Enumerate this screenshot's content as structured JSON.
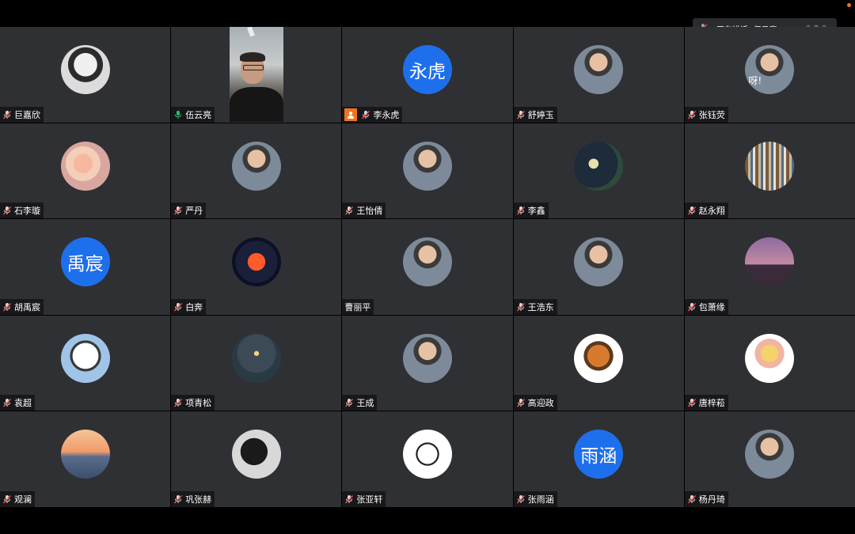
{
  "toast": {
    "speaking_text": "正在讲话: 伍云亮;"
  },
  "colors": {
    "tile_bg": "#2f3033",
    "avatar_blue": "#1e6fec",
    "mic_active": "#29c16c",
    "mic_muted": "#ff4d4d",
    "host_badge": "#f2731f"
  },
  "participants": [
    {
      "name": "巨嘉欣",
      "avatar": "cartoon-girl-avatar",
      "mic": "muted"
    },
    {
      "name": "伍云亮",
      "avatar": "live-video",
      "mic": "active"
    },
    {
      "name": "李永虎",
      "avatar": "letters",
      "letters": "永虎",
      "mic": "muted",
      "host": true
    },
    {
      "name": "舒婷玉",
      "avatar": "photo-avatar",
      "mic": "muted"
    },
    {
      "name": "张钰荧",
      "avatar": "photo-avatar",
      "mic": "muted",
      "avatar_text": "呀!"
    },
    {
      "name": "石李璇",
      "avatar": "clouds-avatar",
      "mic": "muted"
    },
    {
      "name": "严丹",
      "avatar": "photo-avatar",
      "mic": "muted"
    },
    {
      "name": "王怡倩",
      "avatar": "photo-avatar",
      "mic": "muted"
    },
    {
      "name": "李鑫",
      "avatar": "moon-avatar",
      "mic": "muted"
    },
    {
      "name": "赵永翔",
      "avatar": "bookshelf-avatar",
      "mic": "muted"
    },
    {
      "name": "胡禹宸",
      "avatar": "letters",
      "letters": "禹宸",
      "mic": "muted"
    },
    {
      "name": "白奔",
      "avatar": "neon-avatar",
      "mic": "muted"
    },
    {
      "name": "曹丽平",
      "avatar": "photo-avatar",
      "mic": "none"
    },
    {
      "name": "王浩东",
      "avatar": "photo-avatar",
      "mic": "muted"
    },
    {
      "name": "包萧缘",
      "avatar": "sunset-tower-avatar",
      "mic": "muted"
    },
    {
      "name": "袁超",
      "avatar": "cartoon-boy-avatar",
      "mic": "muted"
    },
    {
      "name": "项青松",
      "avatar": "night-sky-avatar",
      "mic": "muted"
    },
    {
      "name": "王成",
      "avatar": "photo-avatar",
      "mic": "muted"
    },
    {
      "name": "高迎政",
      "avatar": "cartoon-fox-avatar",
      "mic": "muted"
    },
    {
      "name": "唐梓菘",
      "avatar": "cartoon-girl-hat-avatar",
      "mic": "muted"
    },
    {
      "name": "观澜",
      "avatar": "ocean-sunset-avatar",
      "mic": "muted"
    },
    {
      "name": "巩张赫",
      "avatar": "tree-silhouette-avatar",
      "mic": "muted"
    },
    {
      "name": "张亚轩",
      "avatar": "cartoon-sketch-avatar",
      "mic": "muted"
    },
    {
      "name": "张雨涵",
      "avatar": "letters",
      "letters": "雨涵",
      "mic": "muted"
    },
    {
      "name": "杨丹琦",
      "avatar": "photo-avatar",
      "mic": "muted"
    }
  ]
}
